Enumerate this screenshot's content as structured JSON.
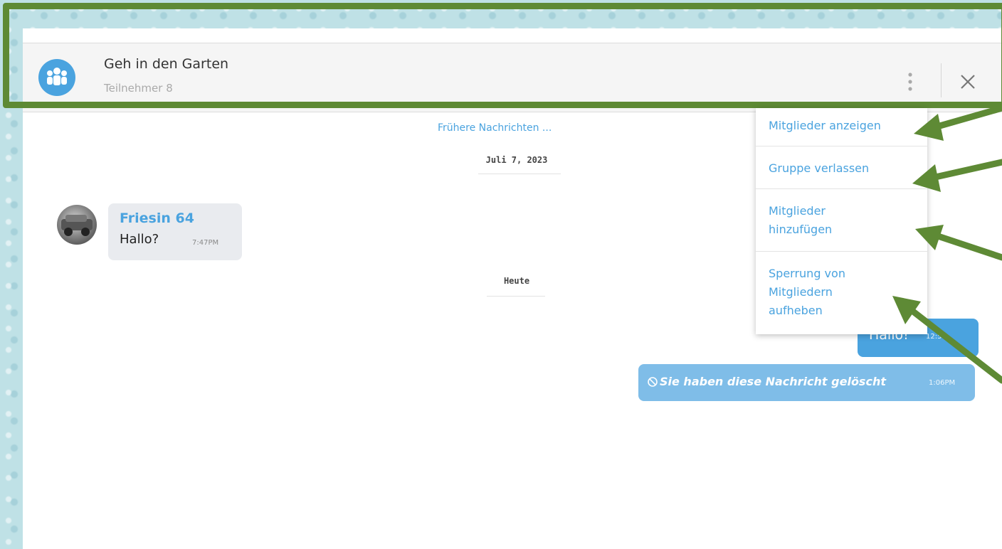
{
  "header": {
    "group_name": "Geh in den Garten",
    "participants": "Teilnehmer 8",
    "avatar_icon": "group-icon",
    "menu_icon": "more-vertical-icon",
    "close_icon": "close-icon"
  },
  "chat": {
    "earlier_link": "Frühere Nachrichten ...",
    "date_1": "Juli 7, 2023",
    "date_2": "Heute",
    "messages": [
      {
        "sender": "Friesin 64",
        "text": "Hallo?",
        "time": "7:47PM"
      },
      {
        "text": "Hallo!",
        "time": "12:5"
      },
      {
        "text": "Sie haben diese Nachricht gelöscht",
        "time": "1:06PM",
        "icon": "blocked-icon"
      }
    ]
  },
  "menu": {
    "items": [
      "Mitglieder anzeigen",
      "Gruppe verlassen",
      "Mitglieder\nhinzufügen",
      "Sperrung von\nMitgliedern\naufheben"
    ]
  },
  "colors": {
    "accent": "#4aa3df",
    "annotation": "#5e8a35",
    "bubble_in": "#e9ebef",
    "bubble_deleted": "#7fbde8"
  }
}
